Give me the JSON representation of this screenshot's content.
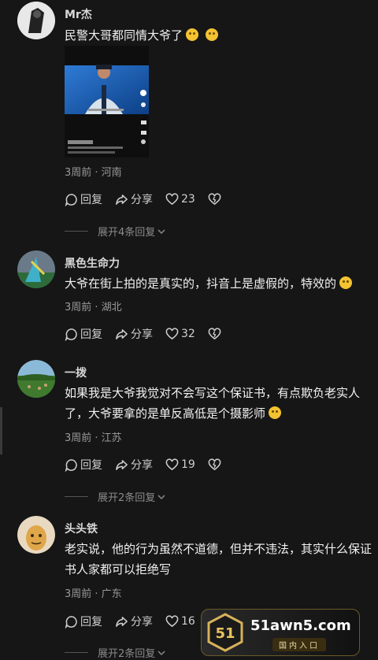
{
  "labels": {
    "reply": "回复",
    "share": "分享"
  },
  "comments": [
    {
      "username": "Mr杰",
      "text": "民警大哥都同情大爷了",
      "meta": "3周前 · 河南",
      "likes": "23",
      "expand": "展开4条回复"
    },
    {
      "username": "黑色生命力",
      "text": "大爷在街上拍的是真实的，抖音上是虚假的，特效的",
      "meta": "3周前 · 湖北",
      "likes": "32"
    },
    {
      "username": "一拨",
      "text": "如果我是大爷我觉对不会写这个保证书，有点欺负老实人了，大爷要拿的是单反高低是个摄影师",
      "meta": "3周前 · 江苏",
      "likes": "19",
      "expand": "展开2条回复"
    },
    {
      "username": "头头铁",
      "text": "老实说，他的行为虽然不道德，但并不违法，其实什么保证书人家都可以拒绝写",
      "meta": "3周前 · 广东",
      "likes": "16",
      "expand": "展开2条回复"
    }
  ],
  "watermark": {
    "logo_number": "51",
    "domain": "51awn5.com",
    "subtitle": "国内入口"
  },
  "colors": {
    "background": "#161616",
    "text": "#f2f2f2",
    "meta": "#9a9a9a",
    "emoji": "#f3c331"
  }
}
